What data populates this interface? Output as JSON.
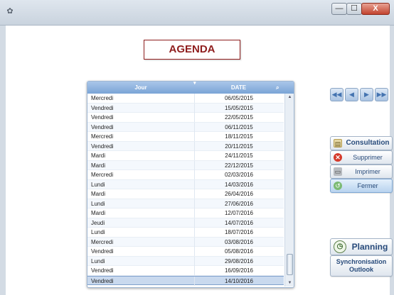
{
  "window": {
    "app_icon": "app-icon",
    "minimize_glyph": "—",
    "maximize_glyph": "☐",
    "close_glyph": "X"
  },
  "title": "AGENDA",
  "table": {
    "columns": [
      "Jour",
      "DATE"
    ],
    "rows": [
      {
        "day": "Mercredi",
        "date": "06/05/2015"
      },
      {
        "day": "Vendredi",
        "date": "15/05/2015"
      },
      {
        "day": "Vendredi",
        "date": "22/05/2015"
      },
      {
        "day": "Vendredi",
        "date": "06/11/2015"
      },
      {
        "day": "Mercredi",
        "date": "18/11/2015"
      },
      {
        "day": "Vendredi",
        "date": "20/11/2015"
      },
      {
        "day": "Mardi",
        "date": "24/11/2015"
      },
      {
        "day": "Mardi",
        "date": "22/12/2015"
      },
      {
        "day": "Mercredi",
        "date": "02/03/2016"
      },
      {
        "day": "Lundi",
        "date": "14/03/2016"
      },
      {
        "day": "Mardi",
        "date": "26/04/2016"
      },
      {
        "day": "Lundi",
        "date": "27/06/2016"
      },
      {
        "day": "Mardi",
        "date": "12/07/2016"
      },
      {
        "day": "Jeudi",
        "date": "14/07/2016"
      },
      {
        "day": "Lundi",
        "date": "18/07/2016"
      },
      {
        "day": "Mercredi",
        "date": "03/08/2016"
      },
      {
        "day": "Vendredi",
        "date": "05/08/2016"
      },
      {
        "day": "Lundi",
        "date": "29/08/2016"
      },
      {
        "day": "Vendredi",
        "date": "16/09/2016"
      },
      {
        "day": "Vendredi",
        "date": "14/10/2016"
      }
    ],
    "selected_index": 19
  },
  "nav": {
    "first": "◀",
    "prev": "◀",
    "next": "▶",
    "last": "▶"
  },
  "buttons": {
    "consultation": "Consultation",
    "supprimer": "Supprimer",
    "imprimer": "Imprimer",
    "fermer": "Fermer",
    "planning": "Planning",
    "sync_line1": "Synchronisation",
    "sync_line2": "Outlook"
  },
  "colors": {
    "title_accent": "#8f1e1e",
    "header_blue": "#7aa4d6",
    "button_text": "#274a7a"
  }
}
